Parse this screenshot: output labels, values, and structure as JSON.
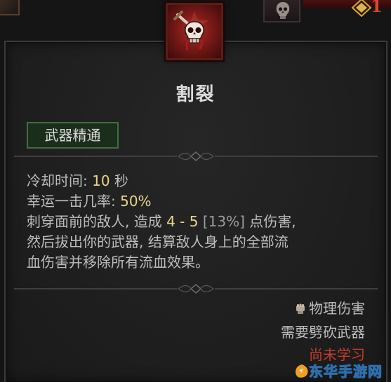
{
  "skill": {
    "title": "割裂",
    "tag": "武器精通",
    "cooldown_label": "冷却时间: ",
    "cooldown_value": "10",
    "cooldown_unit": " 秒",
    "lucky_label": "幸运一击几率: ",
    "lucky_value": "50%",
    "desc_line1_a": "刺穿面前的敌人, 造成 ",
    "desc_damage": "4 - 5",
    "desc_bonus": " [13%]",
    "desc_line1_b": " 点伤害,",
    "desc_line2": "然后拔出你的武器, 结算敌人身上的全部流",
    "desc_line3": "血伤害并移除所有流血效果。",
    "damage_type": "物理伤害",
    "requirement": "需要劈砍武器",
    "status": "尚未学习"
  },
  "header": {
    "level": "1"
  },
  "watermark": {
    "text": "东华手游网"
  },
  "icons": {
    "skill": "skull-dagger-icon",
    "secondary": "skull-icon",
    "level": "gold-diamond-icon",
    "damage": "fist-icon"
  },
  "colors": {
    "highlight": "#e8d48a",
    "tag_bg": "#1b2e1c",
    "tag_border": "#3f6e3d",
    "status_red": "#c23b2b"
  }
}
